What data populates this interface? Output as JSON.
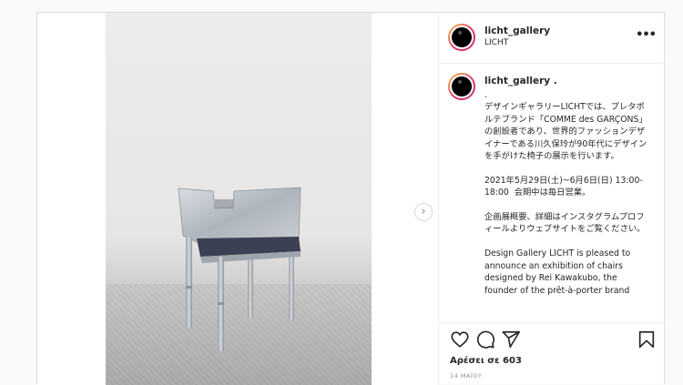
{
  "post": {
    "username": "licht_gallery",
    "subtitle": "LICHT",
    "more_label": "•••",
    "caption_username": "licht_gallery .",
    "caption": ".\nデザインギャラリーLICHTでは、プレタポルテブランド「COMME des GARÇONS」の創設者であり、世界的ファッションデザイナーである川久保玲が90年代にデザインを手がけた椅子の展示を行います。\n\n2021年5月29日(土)~6月6日(日) 13:00-18:00  会期中は毎日営業。\n\n企画展概要、詳細はインスタグラムプロフィールよりウェブサイトをご覧ください。\n\nDesign Gallery LICHT is pleased to announce an exhibition of chairs designed by Rei Kawakubo, the founder of the prêt-à-porter brand",
    "likes": "Αρέσει σε 603",
    "date": "14 ΜΑΪΟΥ",
    "next_arrow": "›"
  },
  "icons": [
    "heart-icon",
    "comment-icon",
    "share-icon",
    "bookmark-icon",
    "chevron-right-icon",
    "more-icon"
  ]
}
